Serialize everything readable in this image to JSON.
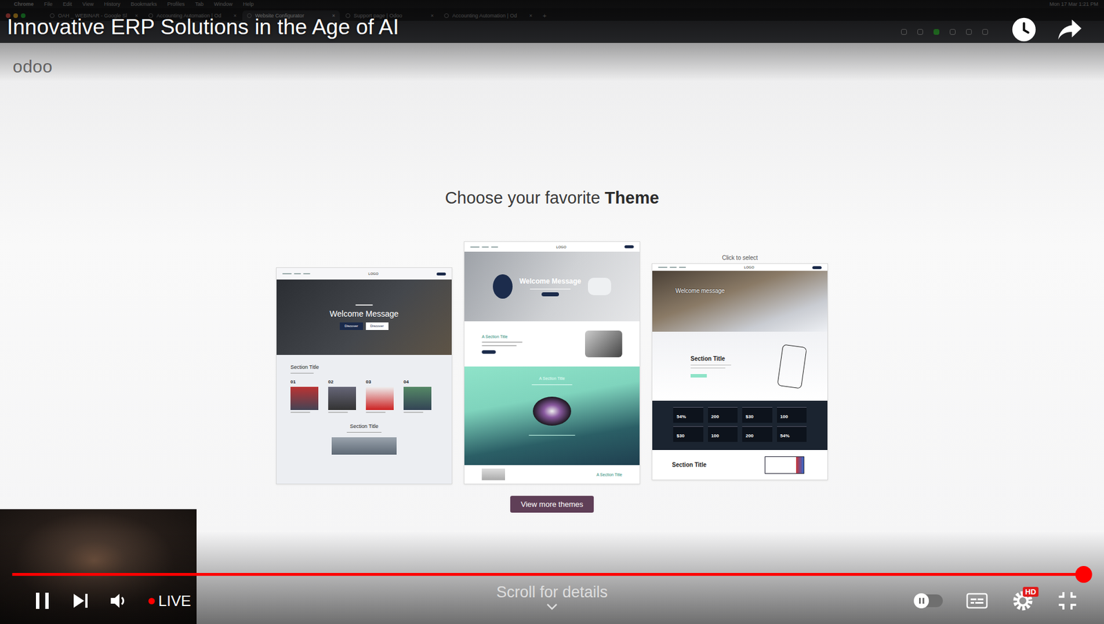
{
  "menubar": {
    "app": "Chrome",
    "items": [
      "File",
      "Edit",
      "View",
      "History",
      "Bookmarks",
      "Profiles",
      "Tab",
      "Window",
      "Help"
    ],
    "clock": "Mon 17 Mar 1:21 PM"
  },
  "browser": {
    "tabs": [
      {
        "label": "OAH _ WEBINAR - Google Sl",
        "selected": false
      },
      {
        "label": "Accounting Automation | Od",
        "selected": false
      },
      {
        "label": "Website Configurator",
        "selected": true
      },
      {
        "label": "Support page | Odoo",
        "selected": false
      },
      {
        "label": "Accounting Automation | Od",
        "selected": false
      }
    ],
    "tab_close": "×",
    "new_tab": "+"
  },
  "page": {
    "logo": "odoo",
    "heading_prefix": "Choose your favorite ",
    "heading_emph": "Theme",
    "themes": [
      {
        "kind": "classic",
        "logo": "LOGO",
        "welcome": "Welcome Message",
        "buttons": [
          "Discover",
          "Discover"
        ],
        "section_title": "Section Title",
        "items": [
          "01",
          "02",
          "03",
          "04"
        ],
        "section_title_2": "Section Title"
      },
      {
        "kind": "wave",
        "logo": "LOGO",
        "welcome": "Welcome Message",
        "section_titles": [
          "A Section Title",
          "A Section Title",
          "A Section Title"
        ]
      },
      {
        "kind": "stats",
        "hover_label": "Click to select",
        "logo": "LOGO",
        "welcome": "Welcome message",
        "section_title": "Section Title",
        "stats": [
          "54%",
          "200",
          "$30",
          "100",
          "$30",
          "100",
          "200",
          "54%"
        ],
        "section_title_2": "Section Title"
      }
    ],
    "more_button": "View more themes"
  },
  "player": {
    "title": "Innovative ERP Solutions in the Age of AI",
    "playing": true,
    "muted": false,
    "live": "LIVE",
    "progress": {
      "level": 1
    },
    "scroll_hint": "Scroll for details",
    "autoplay": false,
    "captions": false,
    "quality": "HD"
  }
}
